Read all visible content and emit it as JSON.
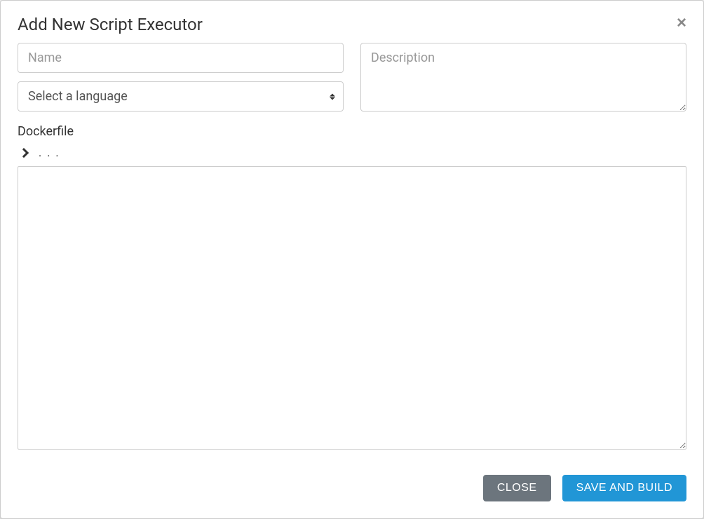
{
  "modal": {
    "title": "Add New Script Executor",
    "close_label": "×"
  },
  "form": {
    "name": {
      "placeholder": "Name",
      "value": ""
    },
    "language": {
      "placeholder": "Select a language",
      "value": ""
    },
    "description": {
      "placeholder": "Description",
      "value": ""
    },
    "dockerfile": {
      "label": "Dockerfile",
      "ellipsis": ". . .",
      "value": ""
    }
  },
  "footer": {
    "close_label": "CLOSE",
    "save_label": "SAVE AND BUILD"
  }
}
